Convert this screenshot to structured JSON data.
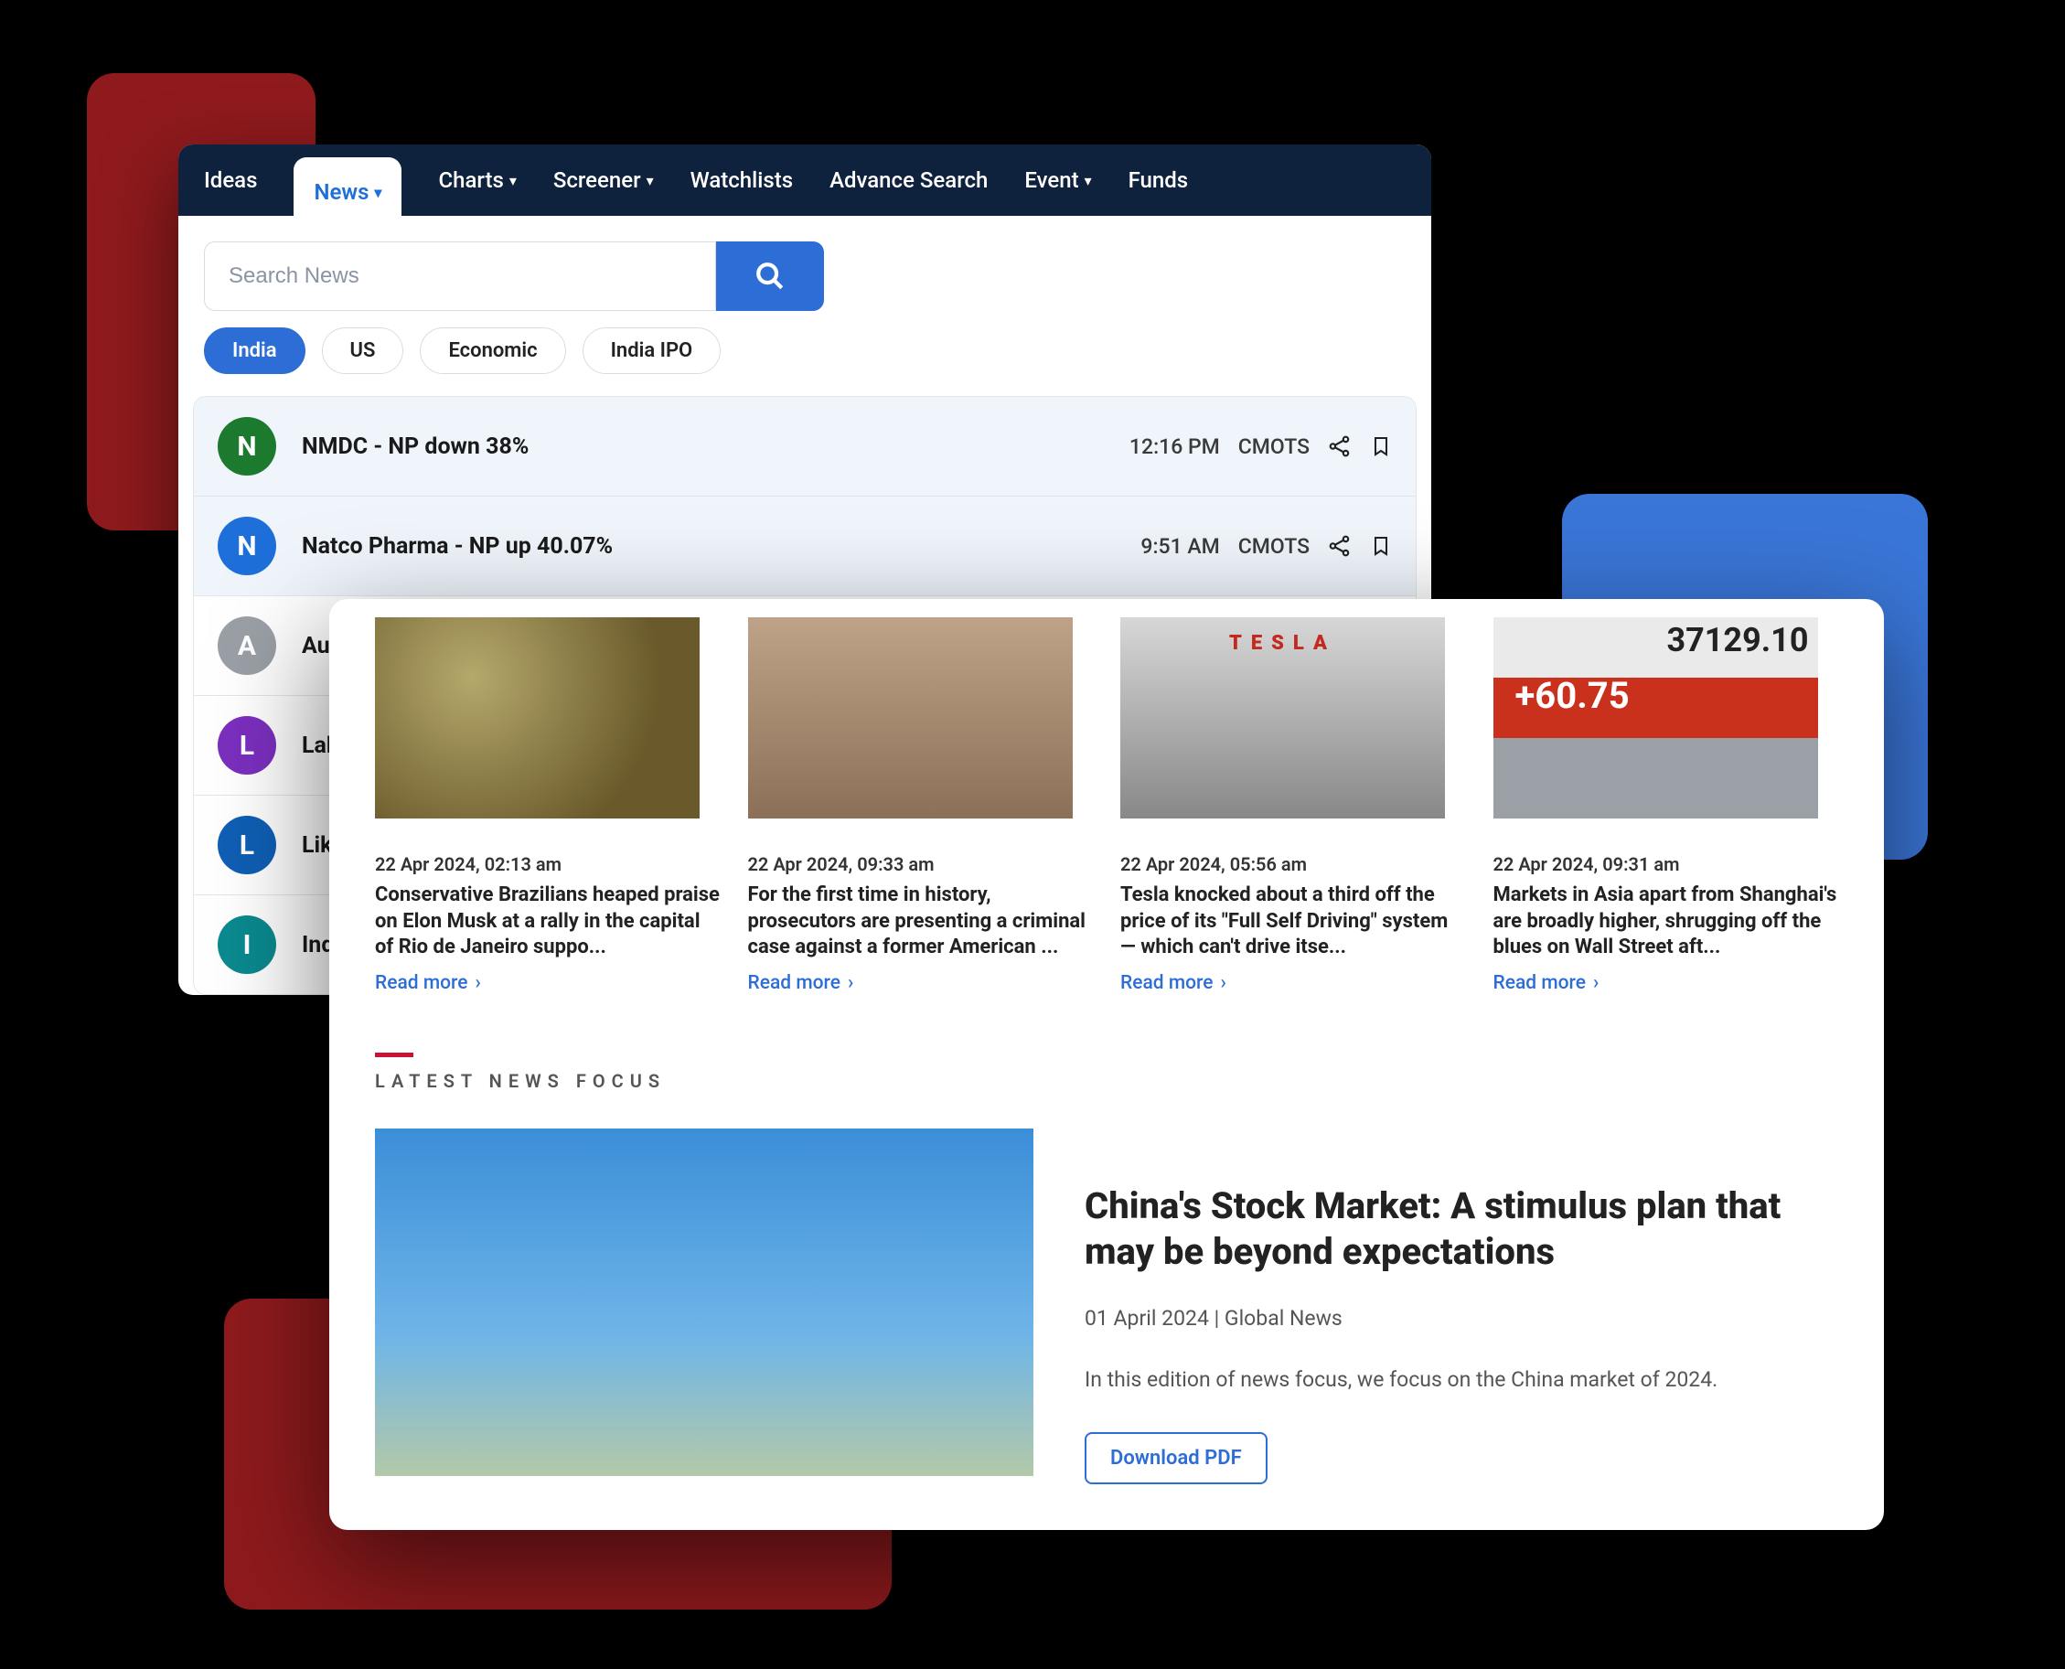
{
  "nav": {
    "items": [
      {
        "label": "Ideas",
        "dropdown": false
      },
      {
        "label": "News",
        "dropdown": true,
        "active": true
      },
      {
        "label": "Charts",
        "dropdown": true
      },
      {
        "label": "Screener",
        "dropdown": true
      },
      {
        "label": "Watchlists",
        "dropdown": false
      },
      {
        "label": "Advance Search",
        "dropdown": false
      },
      {
        "label": "Event",
        "dropdown": true
      },
      {
        "label": "Funds",
        "dropdown": false
      }
    ]
  },
  "search": {
    "placeholder": "Search News",
    "value": ""
  },
  "filters": [
    {
      "label": "India",
      "active": true
    },
    {
      "label": "US",
      "active": false
    },
    {
      "label": "Economic",
      "active": false
    },
    {
      "label": "India IPO",
      "active": false
    }
  ],
  "news_list": [
    {
      "initial": "N",
      "color": "#1c7a2e",
      "title": "NMDC - NP down 38%",
      "time": "12:16 PM",
      "source": "CMOTS",
      "selected": true
    },
    {
      "initial": "N",
      "color": "#1e6fd9",
      "title": "Natco Pharma - NP up 40.07%",
      "time": "9:51 AM",
      "source": "CMOTS",
      "selected": true
    },
    {
      "initial": "A",
      "color": "#9aa0a6",
      "title": "Aut",
      "time": "",
      "source": "",
      "selected": false
    },
    {
      "initial": "L",
      "color": "#7b2fbf",
      "title": "Lak",
      "time": "",
      "source": "",
      "selected": false
    },
    {
      "initial": "L",
      "color": "#0f5fb5",
      "title": "Likl",
      "time": "",
      "source": "",
      "selected": false
    },
    {
      "initial": "I",
      "color": "#0a8a8f",
      "title": "Indo",
      "time": "",
      "source": "",
      "selected": false
    }
  ],
  "cards": [
    {
      "date": "22 Apr 2024, 02:13 am",
      "title": "Conservative Brazilians heaped praise on Elon Musk at a rally in the capital of Rio de Janeiro suppo...",
      "read": "Read more"
    },
    {
      "date": "22 Apr 2024, 09:33 am",
      "title": "For the first time in history, prosecutors are presenting a criminal case against a former American ...",
      "read": "Read more"
    },
    {
      "date": "22 Apr 2024, 05:56 am",
      "title": "Tesla knocked about a third off the price of its \"Full Self Driving\" system — which can't drive itse...",
      "read": "Read more",
      "tesla": "TESLA"
    },
    {
      "date": "22 Apr 2024, 09:31 am",
      "title": "Markets in Asia apart from Shanghai's are broadly higher, shrugging off the blues on Wall Street aft...",
      "read": "Read more",
      "stock_num": "37129.10",
      "stock_delta": "+60.75"
    }
  ],
  "focus": {
    "section": "LATEST NEWS FOCUS",
    "title": "China's Stock Market: A stimulus plan that may be beyond expectations",
    "date": "01 April 2024",
    "sep": " | ",
    "category": "Global News",
    "desc": "In this edition of news focus, we focus on the China market of 2024.",
    "pdf": "Download PDF"
  }
}
